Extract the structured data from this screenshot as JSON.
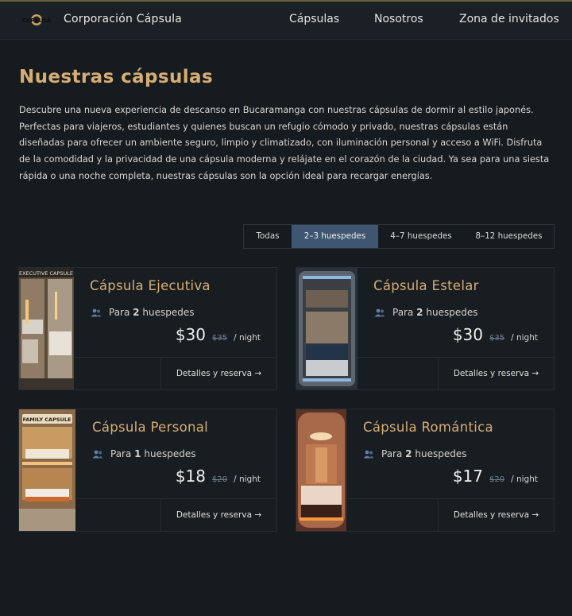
{
  "header": {
    "brand": "Corporación Cápsula",
    "logo_text": "CAPSULA",
    "nav": [
      "Cápsulas",
      "Nosotros",
      "Zona de invitados"
    ]
  },
  "main": {
    "title": "Nuestras cápsulas",
    "intro": "Descubre una nueva experiencia de descanso en Bucaramanga con nuestras cápsulas de dormir al estilo japonés. Perfectas para viajeros, estudiantes y quienes buscan un refugio cómodo y privado, nuestras cápsulas están diseñadas para ofrecer un ambiente seguro, limpio y climatizado, con iluminación personal y acceso a WiFi. Disfruta de la comodidad y la privacidad de una cápsula moderna y relájate en el corazón de la ciudad. Ya sea para una siesta rápida o una noche completa, nuestras cápsulas son la opción ideal para recargar energías.",
    "filters": [
      "Todas",
      "2–3 huespedes",
      "4–7 huespedes",
      "8–12 huespedes"
    ],
    "active_filter": "2–3 huespedes"
  },
  "cards": [
    {
      "title": "Cápsula Ejecutiva",
      "guests_prefix": "Para",
      "guests_count": "2",
      "guests_suffix": "huespedes",
      "price": "$30",
      "old_price": "$35",
      "per_night": "/ night",
      "details": "Detalles y reserva →",
      "image_caption": "EXECUTIVE CAPSULE"
    },
    {
      "title": "Cápsula Estelar",
      "guests_prefix": "Para",
      "guests_count": "2",
      "guests_suffix": "huespedes",
      "price": "$30",
      "old_price": "$35",
      "per_night": "/ night",
      "details": "Detalles y reserva →"
    },
    {
      "title": "Cápsula Personal",
      "guests_prefix": "Para",
      "guests_count": "1",
      "guests_suffix": "huespedes",
      "price": "$18",
      "old_price": "$20",
      "per_night": "/ night",
      "details": "Detalles y reserva →",
      "image_caption": "FAMILY CAPSULE"
    },
    {
      "title": "Cápsula Romántica",
      "guests_prefix": "Para",
      "guests_count": "2",
      "guests_suffix": "huespedes",
      "price": "$17",
      "old_price": "$20",
      "per_night": "/ night",
      "details": "Detalles y reserva →"
    }
  ],
  "colors": {
    "background": "#161b20",
    "accent_gold": "#d7ad73",
    "active_tab": "#3e5672",
    "strike_price": "#6c7f92"
  },
  "icons": {
    "guests": "users-icon",
    "logo": "capsula-logo"
  }
}
